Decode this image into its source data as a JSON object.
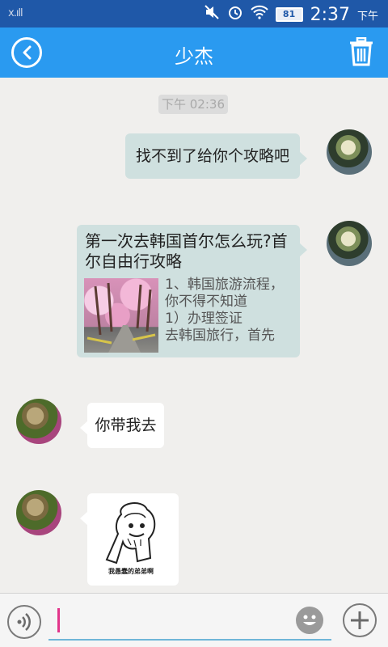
{
  "status_bar": {
    "signal_text": "x.ıll",
    "battery_level": "81",
    "time": "2:37",
    "ampm": "下午",
    "icons": [
      "mute-icon",
      "alarm-icon",
      "wifi-icon",
      "battery-icon"
    ]
  },
  "header": {
    "title": "少杰",
    "back_icon": "back-arrow-icon",
    "action_icon": "trash-icon"
  },
  "chat": {
    "timestamp": "下午 02:36",
    "messages": [
      {
        "side": "right",
        "type": "text",
        "text": "找不到了给你个攻略吧"
      },
      {
        "side": "right",
        "type": "share",
        "title": "第一次去韩国首尔怎么玩?首尔自由行攻略",
        "desc_lines": [
          "1、韩国旅游流程，",
          "你不得不知道",
          "1）办理签证",
          "去韩国旅行，首先"
        ]
      },
      {
        "side": "left",
        "type": "text",
        "text": "你带我去"
      },
      {
        "side": "left",
        "type": "sticker",
        "caption": "我愚蠢的弟弟啊"
      }
    ]
  },
  "input_bar": {
    "value": "",
    "voice_icon": "voice-icon",
    "emoji_icon": "emoji-icon",
    "plus_icon": "plus-icon"
  },
  "colors": {
    "status_bar_bg": "#1f58a8",
    "title_bar_bg": "#2a9af0",
    "chat_bg": "#f0efed",
    "bubble_self": "#cfe0df",
    "bubble_other": "#ffffff",
    "cursor": "#e2348a"
  }
}
